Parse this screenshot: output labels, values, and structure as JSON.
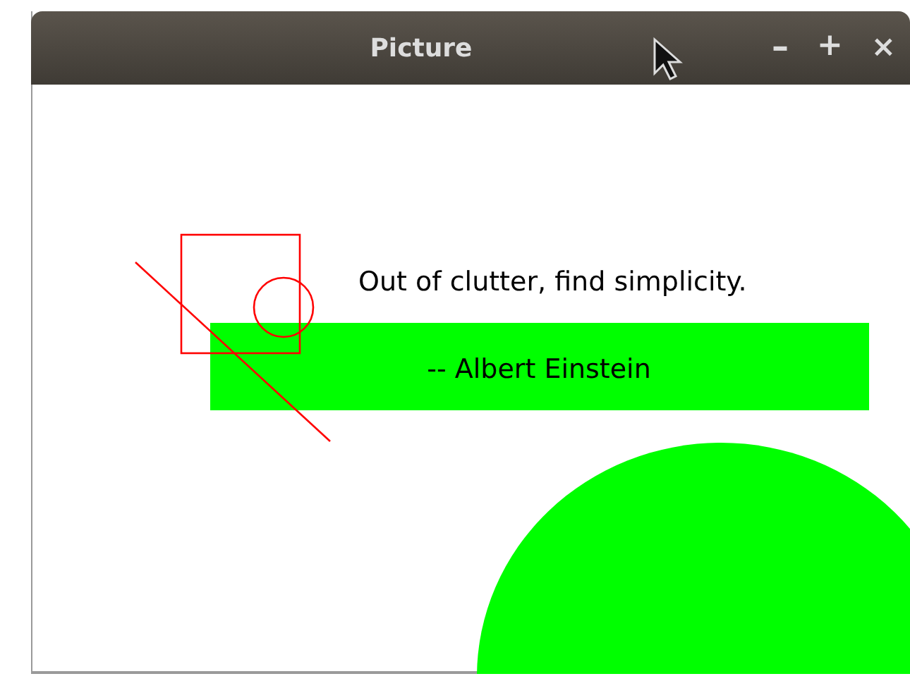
{
  "window": {
    "title": "Picture",
    "controls": [
      {
        "kind": "minimize",
        "label": "–"
      },
      {
        "kind": "maximize",
        "label": "+"
      },
      {
        "kind": "close",
        "label": "×"
      }
    ]
  },
  "canvas": {
    "quote": "Out of clutter, find simplicity.",
    "attribution": "-- Albert Einstein"
  }
}
